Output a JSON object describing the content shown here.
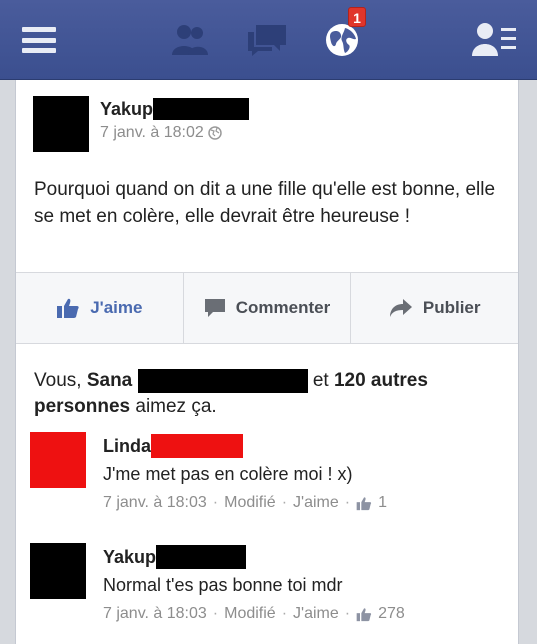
{
  "topbar": {
    "notification_count": "1"
  },
  "post": {
    "author": "Yakup",
    "time": "7 janv. à 18:02",
    "text": "Pourquoi quand on dit a une fille qu'elle est bonne, elle se met en colère, elle devrait être heureuse !"
  },
  "actions": {
    "like": "J'aime",
    "comment": "Commenter",
    "share": "Publier"
  },
  "likes": {
    "prefix": "Vous, ",
    "name": "Sana",
    "middle": "et ",
    "count_text": "120 autres personnes",
    "suffix": " aimez ça."
  },
  "comments": [
    {
      "author": "Linda",
      "text": "J'me met pas en colère moi ! x)",
      "time": "7 janv. à 18:03",
      "edited": "Modifié",
      "like": "J'aime",
      "like_count": "1",
      "redaction_color": "#ee1111",
      "avatar_color": "#ee1111"
    },
    {
      "author": "Yakup",
      "text": "Normal t'es pas bonne toi mdr",
      "time": "7 janv. à 18:03",
      "edited": "Modifié",
      "like": "J'aime",
      "like_count": "278",
      "redaction_color": "#000000",
      "avatar_color": "#000000"
    }
  ],
  "colors": {
    "topbar": "#3b4f8f",
    "link": "#4a6ab0"
  }
}
